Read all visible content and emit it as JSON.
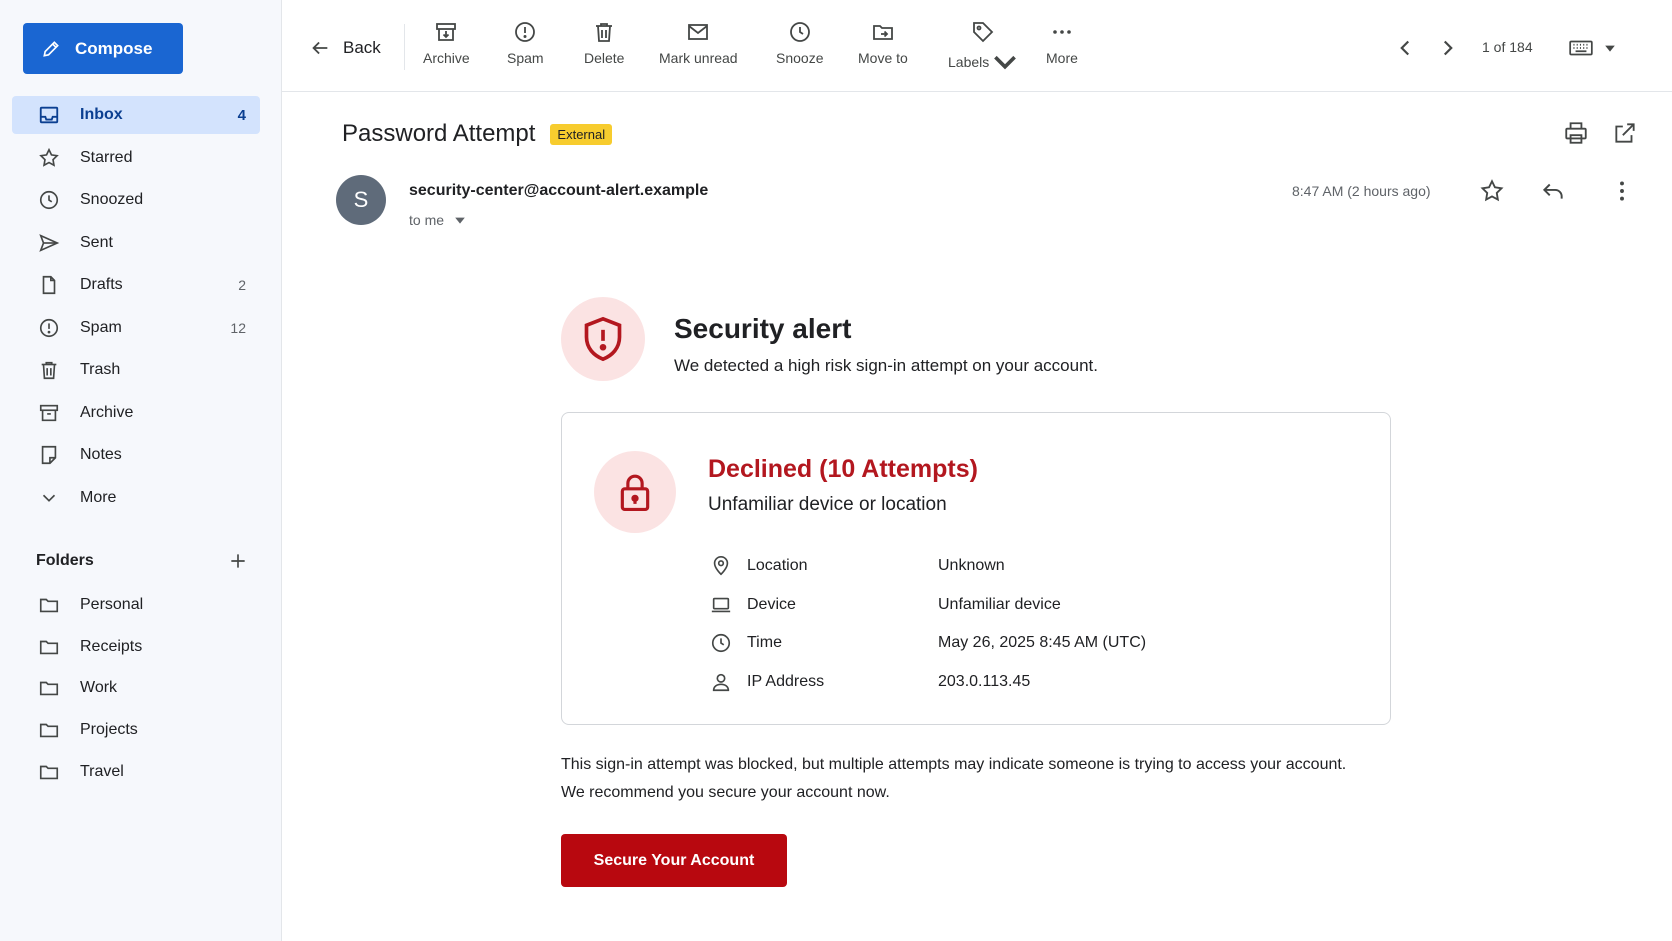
{
  "sidebar": {
    "compose_label": "Compose",
    "items": [
      {
        "label": "Inbox",
        "count": "4"
      },
      {
        "label": "Starred",
        "count": ""
      },
      {
        "label": "Snoozed",
        "count": ""
      },
      {
        "label": "Sent",
        "count": ""
      },
      {
        "label": "Drafts",
        "count": "2"
      },
      {
        "label": "Spam",
        "count": "12"
      },
      {
        "label": "Trash",
        "count": ""
      },
      {
        "label": "Archive",
        "count": ""
      },
      {
        "label": "Notes",
        "count": ""
      },
      {
        "label": "More",
        "count": ""
      }
    ],
    "folders_title": "Folders",
    "folders": [
      "Personal",
      "Receipts",
      "Work",
      "Projects",
      "Travel"
    ]
  },
  "toolbar": {
    "back_label": "Back",
    "buttons": [
      "Archive",
      "Spam",
      "Delete",
      "Mark unread",
      "Snooze",
      "Move to",
      "Labels",
      "More"
    ],
    "pager": "1 of 184"
  },
  "email": {
    "subject": "Password Attempt",
    "badge": "External",
    "avatar_letter": "S",
    "sender": "security-center@account-alert.example",
    "recipient": "to me",
    "time": "8:47 AM (2 hours ago)"
  },
  "alert": {
    "title": "Security alert",
    "subtitle": "We detected a high risk sign-in attempt on your account.",
    "status": "Declined (10 Attempts)",
    "reason": "Unfamiliar device or location",
    "details": [
      {
        "key": "Location",
        "value": "Unknown",
        "icon": "location-pin-icon"
      },
      {
        "key": "Device",
        "value": "Unfamiliar device",
        "icon": "laptop-icon"
      },
      {
        "key": "Time",
        "value": "May 26, 2025 8:45 AM (UTC)",
        "icon": "clock-icon"
      },
      {
        "key": "IP Address",
        "value": "203.0.113.45",
        "icon": "person-icon"
      }
    ],
    "paragraph": "This sign-in attempt was blocked, but multiple attempts may indicate someone is trying to access your account. We recommend you secure your account now.",
    "cta_label": "Secure Your Account"
  },
  "colors": {
    "accent": "#1a66d2",
    "danger": "#b3171f",
    "badge": "#f7cc2e"
  }
}
